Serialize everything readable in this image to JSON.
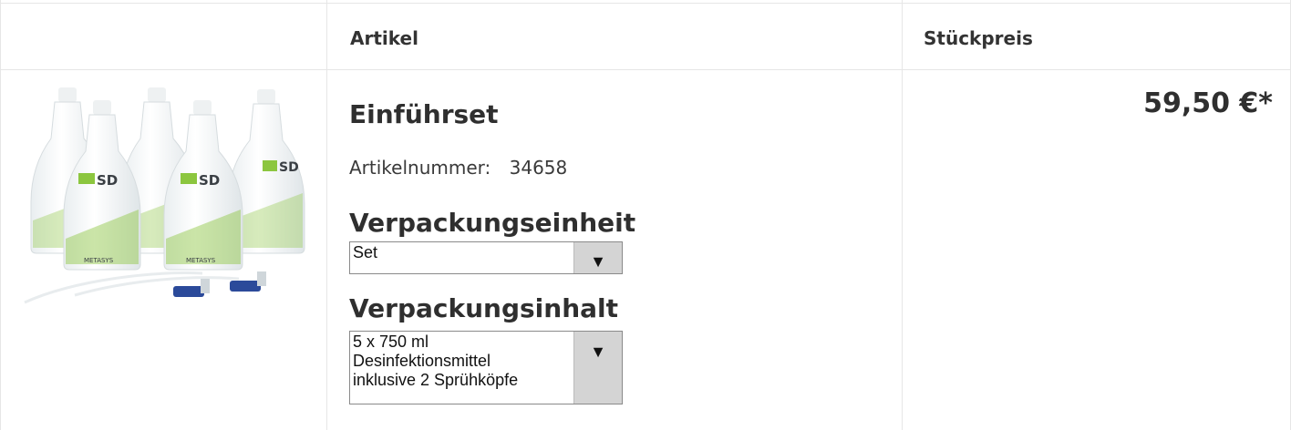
{
  "table": {
    "headers": {
      "image": "",
      "article": "Artikel",
      "unit_price": "Stückpreis"
    }
  },
  "product": {
    "name": "Einführset",
    "article_number_label": "Artikelnummer:",
    "article_number": "34658",
    "packaging_unit_label": "Verpackungseinheit",
    "packaging_unit_value": "Set",
    "packaging_content_label": "Verpackungsinhalt",
    "packaging_content_value": "5 x 750 ml Desinfektionsmittel inklusive 2 Sprühköpfe",
    "packaging_content_lines": [
      "5 x 750 ml",
      "Desinfektionsmittel",
      "inklusive 2 Sprühköpfe"
    ],
    "price": "59,50 €*",
    "image_label_brand": "METASYS",
    "image_label_product": "SD"
  },
  "icons": {
    "dropdown_arrow": "chevron-down-icon"
  },
  "colors": {
    "border": "#e6e6e6",
    "select_button": "#d4d4d4",
    "label_green": "#8cc63f"
  }
}
